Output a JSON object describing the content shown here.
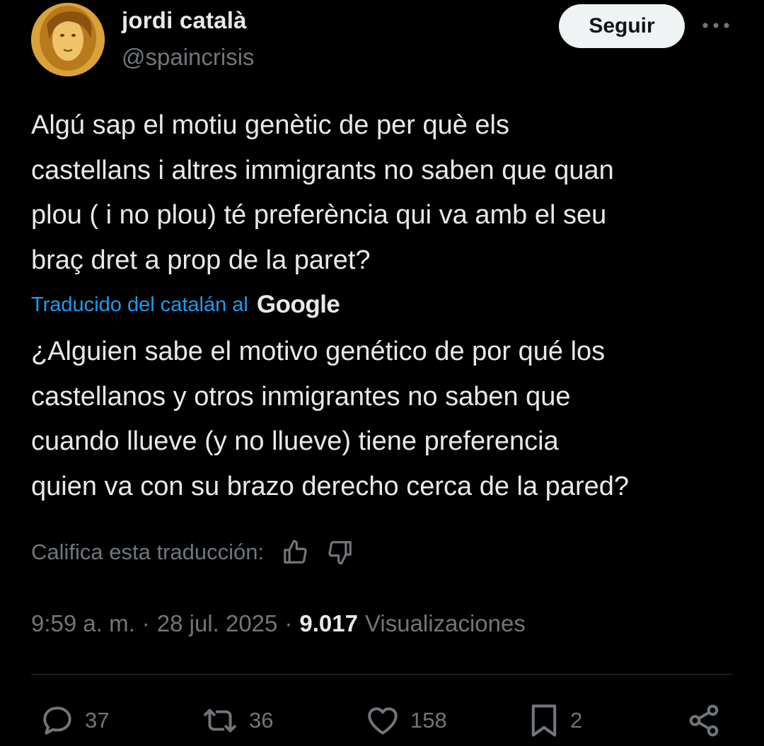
{
  "author": {
    "name": "jordi català",
    "handle": "@spaincrisis"
  },
  "header": {
    "follow_label": "Seguir",
    "more_icon": "more-horizontal-icon"
  },
  "tweet": {
    "text": "Algú sap el motiu genètic de per què els\ncastellans i altres immigrants no saben que quan\nplou ( i no plou) té preferència qui va amb el seu\nbraç dret a prop de la paret?",
    "translated_label": "Traducido del catalán al",
    "translation_provider": "Google",
    "translation": "¿Alguien sabe el motivo genético de por qué los\ncastellanos y otros inmigrantes no saben que\ncuando llueve (y no llueve) tiene preferencia\nquien va con su brazo derecho cerca de la pared?",
    "rate_label": "Califica esta traducción:"
  },
  "meta": {
    "time": "9:59 a. m.",
    "separator": "·",
    "date": "28 jul. 2025",
    "views_count": "9.017",
    "views_label": "Visualizaciones"
  },
  "actions": {
    "replies": "37",
    "reposts": "36",
    "likes": "158",
    "bookmarks": "2"
  },
  "colors": {
    "background": "#000000",
    "text": "#e7e9ea",
    "secondary": "#71767b",
    "link": "#1d9bf0",
    "divider": "#2f3336",
    "follow_bg": "#eff3f4"
  }
}
